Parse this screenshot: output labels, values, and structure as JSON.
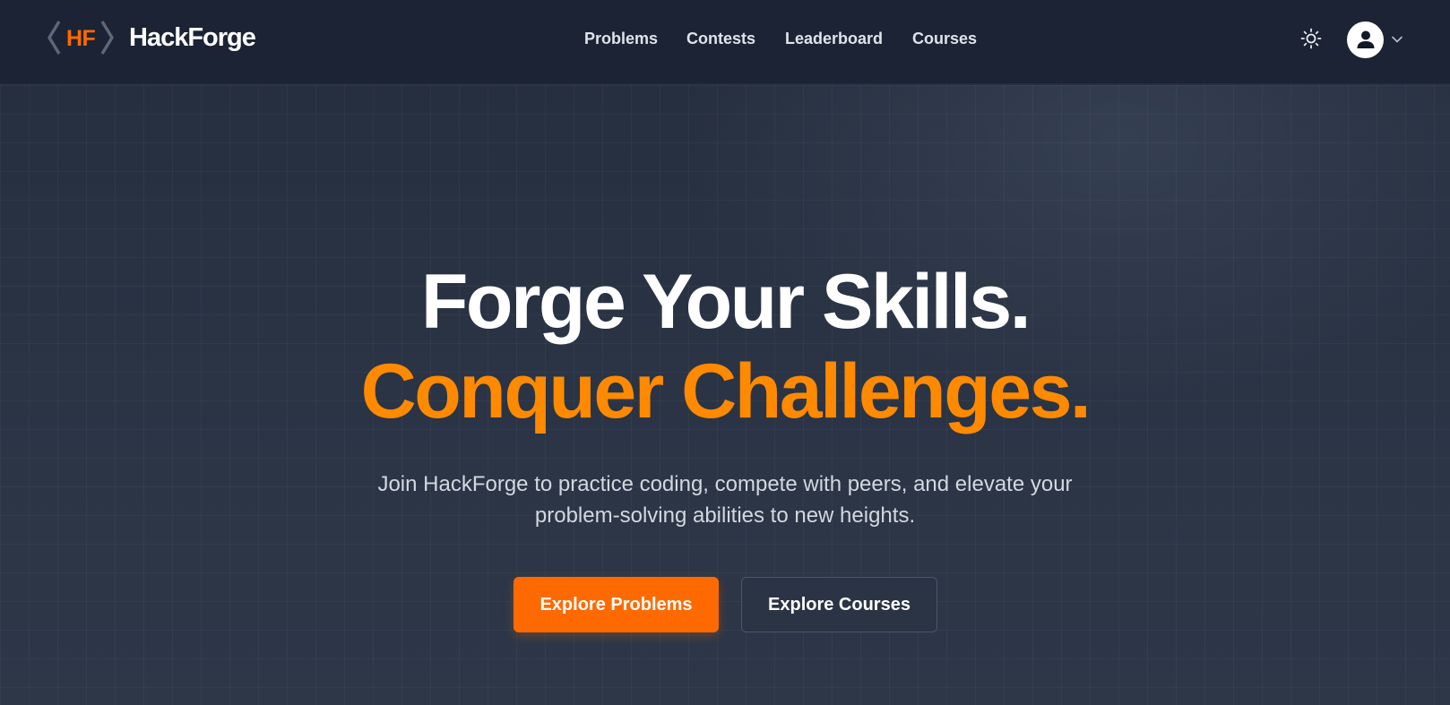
{
  "brand": {
    "logo_text": "HF",
    "name": "HackForge"
  },
  "nav": {
    "items": [
      {
        "label": "Problems"
      },
      {
        "label": "Contests"
      },
      {
        "label": "Leaderboard"
      },
      {
        "label": "Courses"
      }
    ]
  },
  "header_actions": {
    "theme_icon": "sun-icon",
    "avatar_icon": "user-icon",
    "menu_icon": "chevron-down-icon"
  },
  "hero": {
    "headline_line1": "Forge Your Skills.",
    "headline_line2": "Conquer Challenges.",
    "subtext": "Join HackForge to practice coding, compete with peers, and elevate your problem-solving abilities to new heights.",
    "primary_button": "Explore Problems",
    "secondary_button": "Explore Courses"
  },
  "colors": {
    "accent": "#ff6a00",
    "headline_accent": "#ff8a00",
    "nav_background": "#1b2334",
    "page_background": "#273142"
  }
}
